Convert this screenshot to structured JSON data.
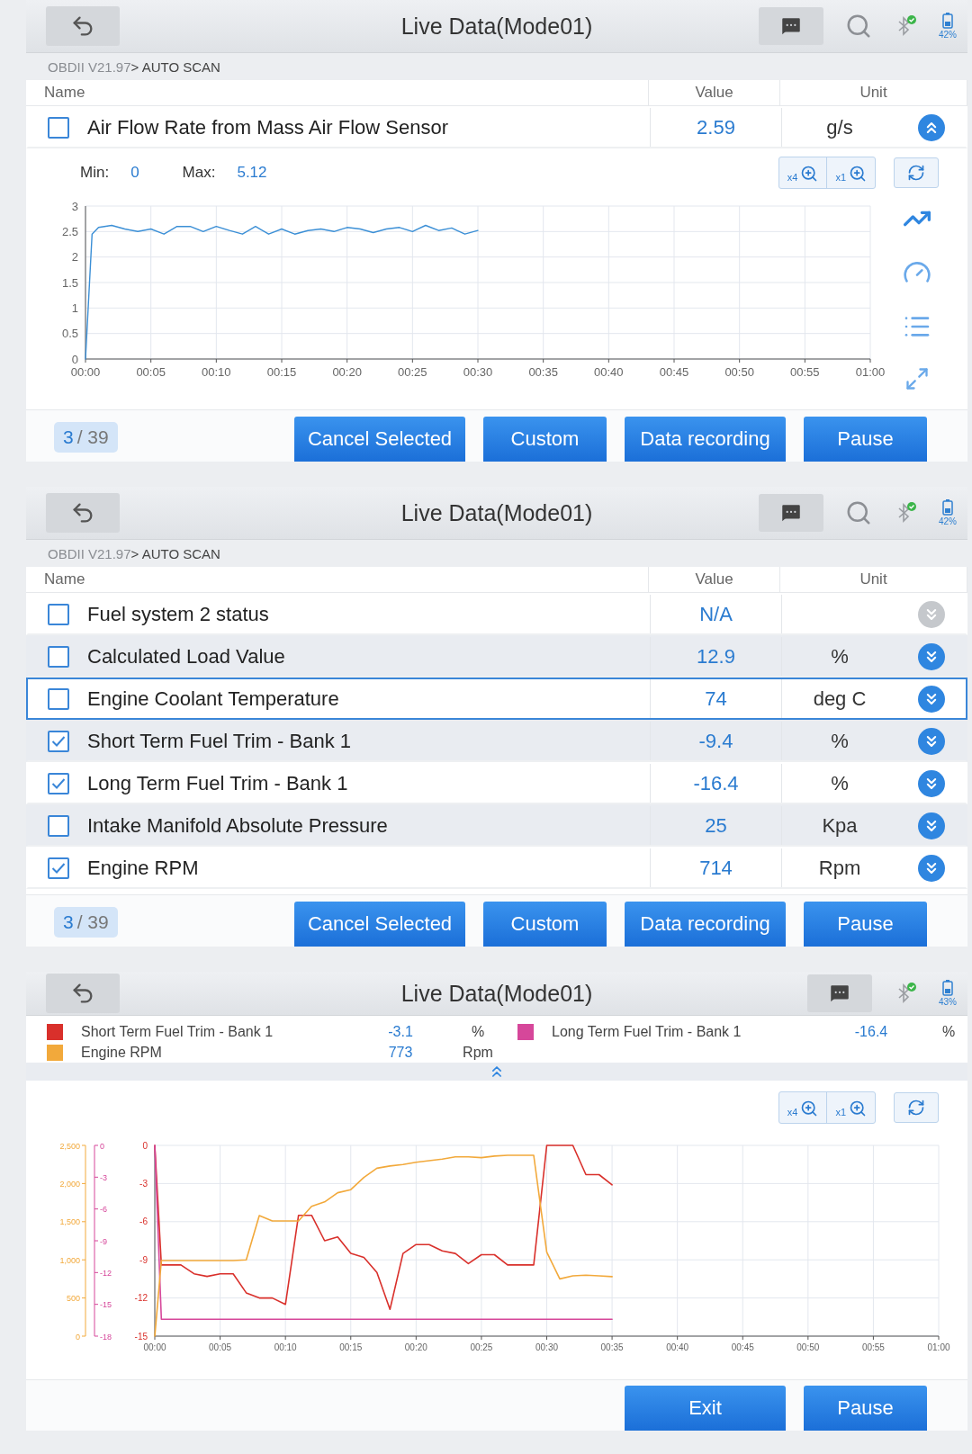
{
  "screens": [
    {
      "kind": "single_graph",
      "header": {
        "title": "Live Data(Mode01)",
        "search": true,
        "battery": "42%"
      },
      "breadcrumb": {
        "version": "OBDII V21.97",
        "path": "> AUTO SCAN"
      },
      "columns": [
        "Name",
        "Value",
        "Unit"
      ],
      "rows": [
        {
          "name": "Air Flow Rate from Mass Air Flow Sensor",
          "value": "2.59",
          "unit": "g/s",
          "checked": false,
          "expanded": true,
          "enabled": true,
          "selected": false
        }
      ],
      "graph": {
        "min_label": "Min:",
        "min": "0",
        "max_label": "Max:",
        "max": "5.12",
        "zoom_x": "x4",
        "zoom_y": "x1",
        "chart_data": {
          "type": "line",
          "grid": true,
          "x": [
            0,
            0.5,
            1,
            2,
            3,
            4,
            5,
            6,
            7,
            8,
            9,
            10,
            11,
            12,
            13,
            14,
            15,
            16,
            17,
            18,
            19,
            20,
            21,
            22,
            23,
            24,
            25,
            26,
            27,
            28,
            29,
            30
          ],
          "xlim": [
            0,
            60
          ],
          "ylim": [
            0,
            3
          ],
          "xticks": [
            {
              "value": 0,
              "label": "00:00"
            },
            {
              "value": 5,
              "label": "00:05"
            },
            {
              "value": 10,
              "label": "00:10"
            },
            {
              "value": 15,
              "label": "00:15"
            },
            {
              "value": 20,
              "label": "00:20"
            },
            {
              "value": 25,
              "label": "00:25"
            },
            {
              "value": 30,
              "label": "00:30"
            },
            {
              "value": 35,
              "label": "00:35"
            },
            {
              "value": 40,
              "label": "00:40"
            },
            {
              "value": 45,
              "label": "00:45"
            },
            {
              "value": 50,
              "label": "00:50"
            },
            {
              "value": 55,
              "label": "00:55"
            },
            {
              "value": 60,
              "label": "01:00"
            }
          ],
          "yticks": [
            0,
            0.5,
            1,
            1.5,
            2,
            2.5,
            3
          ],
          "series": [
            {
              "color": "#3b8fd6",
              "values": [
                0,
                2.45,
                2.58,
                2.62,
                2.55,
                2.5,
                2.55,
                2.45,
                2.6,
                2.6,
                2.5,
                2.6,
                2.52,
                2.45,
                2.6,
                2.45,
                2.55,
                2.45,
                2.52,
                2.55,
                2.5,
                2.58,
                2.55,
                2.48,
                2.55,
                2.58,
                2.5,
                2.62,
                2.52,
                2.57,
                2.45,
                2.52
              ]
            }
          ]
        }
      },
      "footer": {
        "page": "3",
        "total": "/ 39",
        "buttons": [
          "Cancel Selected",
          "Custom",
          "Data recording",
          "Pause"
        ]
      }
    },
    {
      "kind": "list",
      "header": {
        "title": "Live Data(Mode01)",
        "search": true,
        "battery": "42%"
      },
      "breadcrumb": {
        "version": "OBDII V21.97",
        "path": "> AUTO SCAN"
      },
      "columns": [
        "Name",
        "Value",
        "Unit"
      ],
      "rows": [
        {
          "name": "Fuel system 2 status",
          "value": "N/A",
          "checked": false,
          "expanded": false,
          "enabled": false,
          "selected": false
        },
        {
          "name": "Calculated Load Value",
          "value": "12.9",
          "unit": "%",
          "checked": false,
          "expanded": false,
          "enabled": true,
          "selected": false
        },
        {
          "name": "Engine Coolant Temperature",
          "value": "74",
          "unit": "deg C",
          "checked": false,
          "expanded": false,
          "enabled": true,
          "selected": true
        },
        {
          "name": "Short Term Fuel Trim - Bank 1",
          "value": "-9.4",
          "unit": "%",
          "checked": true,
          "expanded": false,
          "enabled": true,
          "selected": false
        },
        {
          "name": "Long Term Fuel Trim - Bank 1",
          "value": "-16.4",
          "unit": "%",
          "checked": true,
          "expanded": false,
          "enabled": true,
          "selected": false
        },
        {
          "name": "Intake Manifold Absolute Pressure",
          "value": "25",
          "unit": "Kpa",
          "checked": false,
          "expanded": false,
          "enabled": true,
          "selected": false
        },
        {
          "name": "Engine RPM",
          "value": "714",
          "unit": "Rpm",
          "checked": true,
          "expanded": false,
          "enabled": true,
          "selected": false
        }
      ],
      "footer": {
        "page": "3",
        "total": "/ 39",
        "buttons": [
          "Cancel Selected",
          "Custom",
          "Data recording",
          "Pause"
        ]
      }
    },
    {
      "kind": "multi_graph",
      "header": {
        "title": "Live Data(Mode01)",
        "search": false,
        "battery": "43%"
      },
      "legend": [
        {
          "value": "-3.1",
          "unit": "%"
        },
        {
          "value": "-16.4",
          "unit": "%"
        },
        {
          "value": "773",
          "unit": "Rpm"
        }
      ],
      "graph": {
        "zoom_x": "x4",
        "zoom_y": "x1",
        "chart_data": {
          "type": "line",
          "grid": true,
          "x": [
            0,
            0.5,
            1,
            2,
            3,
            4,
            5,
            6,
            7,
            8,
            9,
            10,
            11,
            12,
            13,
            14,
            15,
            16,
            17,
            18,
            19,
            20,
            21,
            22,
            23,
            24,
            25,
            26,
            27,
            28,
            29,
            30,
            31,
            32,
            33,
            34,
            35
          ],
          "xlim": [
            0,
            60
          ],
          "ylim": [
            -15,
            0
          ],
          "xticks": [
            {
              "value": 0,
              "label": "00:00"
            },
            {
              "value": 5,
              "label": "00:05"
            },
            {
              "value": 10,
              "label": "00:10"
            },
            {
              "value": 15,
              "label": "00:15"
            },
            {
              "value": 20,
              "label": "00:20"
            },
            {
              "value": 25,
              "label": "00:25"
            },
            {
              "value": 30,
              "label": "00:30"
            },
            {
              "value": 35,
              "label": "00:35"
            },
            {
              "value": 40,
              "label": "00:40"
            },
            {
              "value": 45,
              "label": "00:45"
            },
            {
              "value": 50,
              "label": "00:50"
            },
            {
              "value": 55,
              "label": "00:55"
            },
            {
              "value": 60,
              "label": "01:00"
            }
          ],
          "yticks": [
            {
              "value": -15,
              "label": "-15"
            },
            {
              "value": -12,
              "label": "-12"
            },
            {
              "value": -9,
              "label": "-9"
            },
            {
              "value": -6,
              "label": "-6"
            },
            {
              "value": -3,
              "label": "-3"
            },
            {
              "value": 0,
              "label": "0"
            }
          ],
          "y2lim": [
            0,
            2500
          ],
          "y2ticks": [
            {
              "value": 0,
              "label": "0"
            },
            {
              "value": 500,
              "label": "500"
            },
            {
              "value": 1000,
              "label": "1,000"
            },
            {
              "value": 1500,
              "label": "1,500"
            },
            {
              "value": 2000,
              "label": "2,000"
            },
            {
              "value": 2500,
              "label": "2,500"
            }
          ],
          "y3lim": [
            -18,
            0
          ],
          "y3ticks": [
            {
              "value": -18,
              "label": "-18"
            },
            {
              "value": -15,
              "label": "-15"
            },
            {
              "value": -12,
              "label": "-12"
            },
            {
              "value": -9,
              "label": "-9"
            },
            {
              "value": -6,
              "label": "-6"
            },
            {
              "value": -3,
              "label": "-3"
            },
            {
              "value": 0,
              "label": "0"
            }
          ],
          "series": [
            {
              "name": "Short Term Fuel Trim - Bank 1",
              "color": "#d9302b",
              "values": [
                0,
                -9.4,
                -9.4,
                -9.4,
                -10.1,
                -10.3,
                -10.1,
                -10.1,
                -11.6,
                -12,
                -12,
                -12.5,
                -5.5,
                -5.5,
                -7.5,
                -7.2,
                -8.5,
                -8.8,
                -10,
                -12.9,
                -8.5,
                -7.8,
                -7.8,
                -8.3,
                -8.5,
                -9.3,
                -8.6,
                -8.6,
                -9.4,
                -9.4,
                -9.4,
                0,
                0,
                0,
                -2.3,
                -2.3,
                -3.1
              ]
            },
            {
              "name": "Long Term Fuel Trim - Bank 1",
              "color": "#d6479a",
              "axis": "y3",
              "values": [
                0,
                -16.4,
                -16.4,
                -16.4,
                -16.4,
                -16.4,
                -16.4,
                -16.4,
                -16.4,
                -16.4,
                -16.4,
                -16.4,
                -16.4,
                -16.4,
                -16.4,
                -16.4,
                -16.4,
                -16.4,
                -16.4,
                -16.4,
                -16.4,
                -16.4,
                -16.4,
                -16.4,
                -16.4,
                -16.4,
                -16.4,
                -16.4,
                -16.4,
                -16.4,
                -16.4,
                -16.4,
                -16.4,
                -16.4,
                -16.4,
                -16.4,
                -16.4
              ]
            },
            {
              "name": "Engine RPM",
              "color": "#f2a93b",
              "axis": "y2",
              "values": [
                0,
                990,
                990,
                990,
                990,
                990,
                990,
                990,
                1000,
                1580,
                1510,
                1510,
                1510,
                1700,
                1760,
                1880,
                1920,
                2080,
                2200,
                2230,
                2250,
                2280,
                2300,
                2320,
                2350,
                2350,
                2340,
                2360,
                2370,
                2370,
                2370,
                1100,
                750,
                790,
                800,
                790,
                780
              ]
            }
          ]
        }
      },
      "footer": {
        "buttons": [
          "Exit",
          "Pause"
        ]
      }
    }
  ]
}
